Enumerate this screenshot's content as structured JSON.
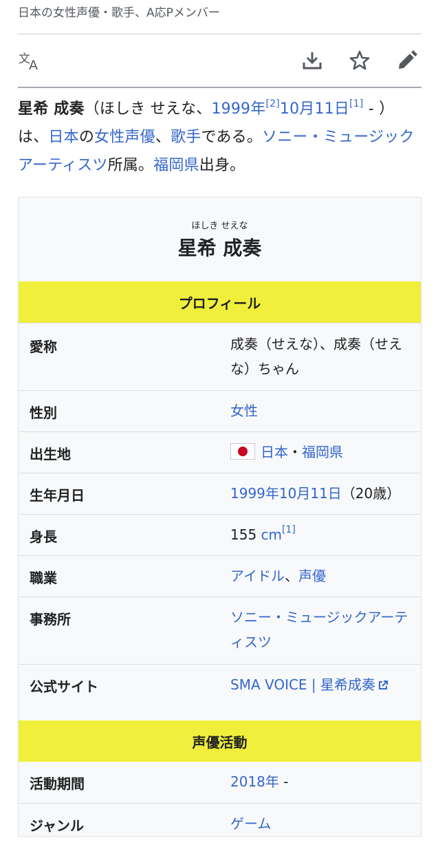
{
  "header": {
    "description": "日本の女性声優・歌手、A応Pメンバー"
  },
  "actions": {
    "language": "language-icon",
    "download": "download-icon",
    "watch": "star-icon",
    "edit": "pencil-icon"
  },
  "intro": {
    "name": "星希 成奏",
    "paren_open": "（ほしき せえな、",
    "birth_year": "1999年",
    "ref2": "[2]",
    "birth_date": "10月11日",
    "ref1": "[1]",
    "paren_close": " - ）",
    "t1": "は、",
    "link_japan": "日本",
    "t2": "の",
    "link_va": "女性声優",
    "t3": "、",
    "link_singer": "歌手",
    "t4": "である。",
    "link_agency": "ソニー・ミュージックアーティスツ",
    "t5": "所属。",
    "link_pref": "福岡県",
    "t6": "出身。"
  },
  "infobox": {
    "ruby": "ほしき せえな",
    "title": "星希 成奏",
    "section_profile": "プロフィール",
    "section_va": "声優活動",
    "rows": [
      {
        "key": "愛称",
        "value": "成奏（せえな）、成奏（せえな）ちゃん"
      },
      {
        "key": "性別",
        "value": "女性"
      },
      {
        "key": "出生地",
        "value_link1": "日本",
        "sep": "・",
        "value_link2": "福岡県"
      },
      {
        "key": "生年月日",
        "value_link": "1999年10月11日",
        "value_text": "（20歳）"
      },
      {
        "key": "身長",
        "value_num": "155 ",
        "value_link": "cm",
        "ref": "[1]"
      },
      {
        "key": "職業",
        "value_link1": "アイドル",
        "sep": "、",
        "value_link2": "声優"
      },
      {
        "key": "事務所",
        "value": "ソニー・ミュージックアーティスツ"
      },
      {
        "key": "公式サイト",
        "value": "SMA VOICE | 星希成奏"
      },
      {
        "key": "活動期間",
        "value_link": "2018年",
        "value_text": " -"
      },
      {
        "key": "ジャンル",
        "value": "ゲーム"
      }
    ]
  },
  "colors": {
    "link": "#3366cc",
    "section_bg": "#f0ef3b",
    "infobox_bg": "#f8f9fa"
  }
}
